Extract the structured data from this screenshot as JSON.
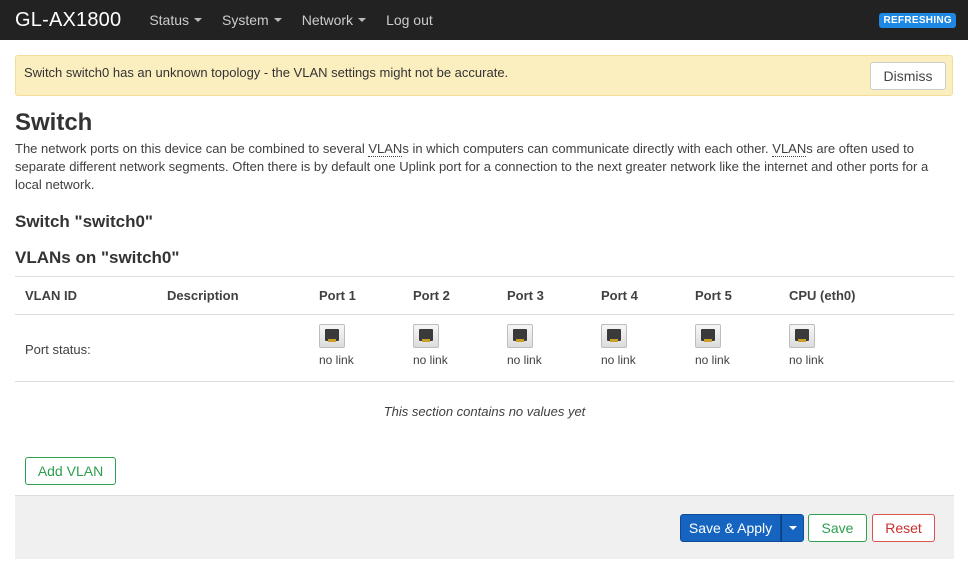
{
  "navbar": {
    "brand": "GL-AX1800",
    "menu": [
      "Status",
      "System",
      "Network"
    ],
    "logout": "Log out",
    "badge": "REFRESHING",
    "badge_color": "#1e88e5"
  },
  "alert": {
    "message": "Switch switch0 has an unknown topology - the VLAN settings might not be accurate.",
    "dismiss_label": "Dismiss"
  },
  "page": {
    "title": "Switch",
    "description_parts": [
      "The network ports on this device can be combined to several ",
      "VLAN",
      "s in which computers can communicate directly with each other. ",
      "VLAN",
      "s are often used to separate different network segments. Often there is by default one Uplink port for a connection to the next greater network like the internet and other ports for a local network."
    ],
    "switch_heading": "Switch \"switch0\"",
    "vlans_heading": "VLANs on \"switch0\""
  },
  "table": {
    "columns": [
      "VLAN ID",
      "Description",
      "Port 1",
      "Port 2",
      "Port 3",
      "Port 4",
      "Port 5",
      "CPU (eth0)"
    ],
    "status_label": "Port status:",
    "port_status": [
      "no link",
      "no link",
      "no link",
      "no link",
      "no link",
      "no link"
    ],
    "empty_message": "This section contains no values yet"
  },
  "actions": {
    "add_vlan": "Add VLAN",
    "save_apply": "Save & Apply",
    "save": "Save",
    "reset": "Reset"
  },
  "colors": {
    "navbar_bg": "#222222",
    "alert_bg": "#fcefbf",
    "primary": "#1565c0",
    "positive": "#2e9e4f",
    "negative": "#d9534f"
  }
}
